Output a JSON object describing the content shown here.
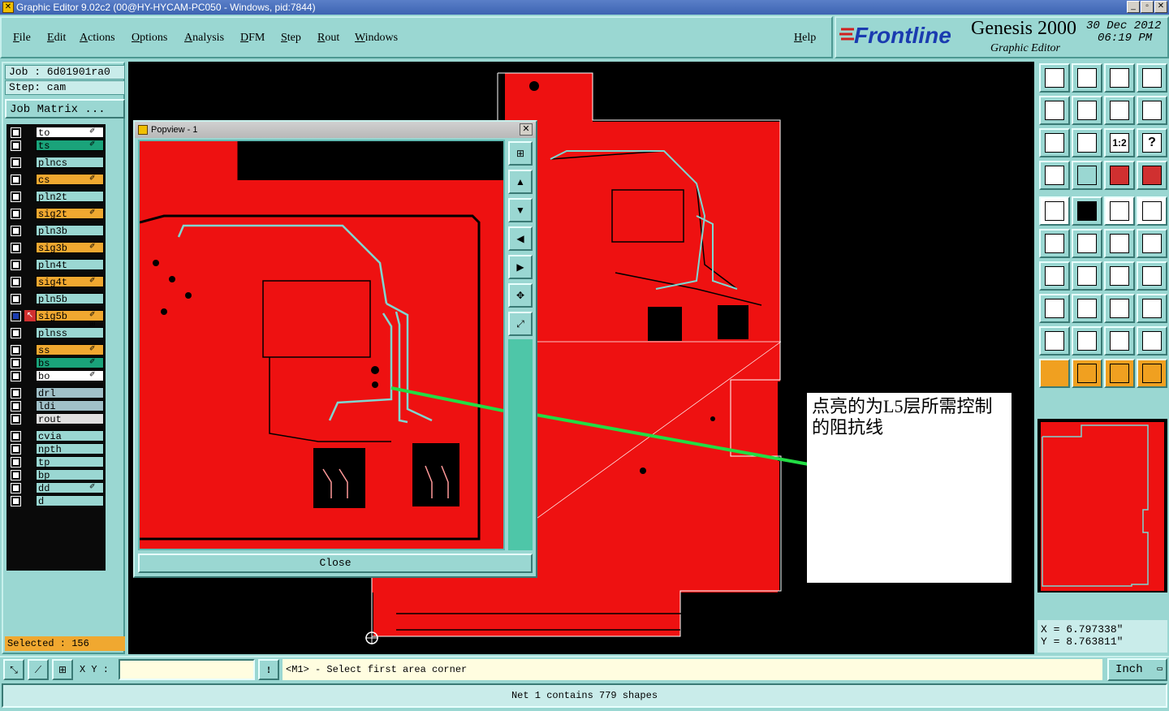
{
  "window": {
    "title": "Graphic Editor 9.02c2 (00@HY-HYCAM-PC050 - Windows, pid:7844)",
    "btn_min": "_",
    "btn_max": "▫",
    "btn_close": "✕"
  },
  "menu": {
    "items": [
      "File",
      "Edit",
      "Actions",
      "Options",
      "Analysis",
      "DFM",
      "Step",
      "Rout",
      "Windows"
    ],
    "help": "Help"
  },
  "brand": {
    "logo": "Frontline",
    "product": "Genesis 2000",
    "subtitle": "Graphic Editor",
    "date": "30 Dec 2012",
    "time": "06:19 PM"
  },
  "job": {
    "job": "Job : 6d01901ra0",
    "step": "Step: cam",
    "matrix_btn": "Job Matrix ..."
  },
  "layers": [
    {
      "name": "to",
      "color": "#ffffff",
      "mark": "✐"
    },
    {
      "name": "ts",
      "color": "#1aa37a",
      "mark": "✐"
    },
    {
      "name": "plncs",
      "color": "#9ad7d2",
      "mark": ""
    },
    {
      "name": "cs",
      "color": "#f0a830",
      "mark": "✐"
    },
    {
      "name": "pln2t",
      "color": "#9ad7d2",
      "mark": ""
    },
    {
      "name": "sig2t",
      "color": "#f0a830",
      "mark": "✐"
    },
    {
      "name": "pln3b",
      "color": "#9ad7d2",
      "mark": ""
    },
    {
      "name": "sig3b",
      "color": "#f0a830",
      "mark": "✐"
    },
    {
      "name": "pln4t",
      "color": "#9ad7d2",
      "mark": ""
    },
    {
      "name": "sig4t",
      "color": "#f0a830",
      "mark": "✐"
    },
    {
      "name": "pln5b",
      "color": "#9ad7d2",
      "mark": ""
    },
    {
      "name": "sig5b",
      "color": "#f0a830",
      "mark": "✐ ⊞"
    },
    {
      "name": "plnss",
      "color": "#9ad7d2",
      "mark": ""
    },
    {
      "name": "ss",
      "color": "#f0a830",
      "mark": "✐"
    },
    {
      "name": "bs",
      "color": "#1aa37a",
      "mark": "✐"
    },
    {
      "name": "bo",
      "color": "#ffffff",
      "mark": "✐"
    },
    {
      "name": "drl",
      "color": "#a0c0c8",
      "mark": ""
    },
    {
      "name": "ldi",
      "color": "#a0c0c8",
      "mark": ""
    },
    {
      "name": "rout",
      "color": "#e0e0e0",
      "mark": ""
    },
    {
      "name": "cvia",
      "color": "#9ad7d2",
      "mark": ""
    },
    {
      "name": "npth",
      "color": "#9ad7d2",
      "mark": ""
    },
    {
      "name": "tp",
      "color": "#9ad7d2",
      "mark": ""
    },
    {
      "name": "bp",
      "color": "#9ad7d2",
      "mark": ""
    },
    {
      "name": "dd",
      "color": "#9ad7d2",
      "mark": "✐"
    },
    {
      "name": "d",
      "color": "#9ad7d2",
      "mark": ""
    }
  ],
  "selected": "Selected : 156",
  "popview": {
    "title": "Popview - 1",
    "close": "Close"
  },
  "annotation": "点亮的为L5层所需控制的阻抗线",
  "coords": {
    "x": "X = 6.797338\"",
    "y": "Y = 8.763811\""
  },
  "bottom": {
    "xy_label": "X Y :",
    "xy_value": "",
    "prompt": "<M1> - Select first area corner",
    "unit": "Inch",
    "status": "Net 1 contains 779 shapes"
  },
  "toolbar_labels": {
    "one_two": "1:2",
    "question": "?"
  }
}
